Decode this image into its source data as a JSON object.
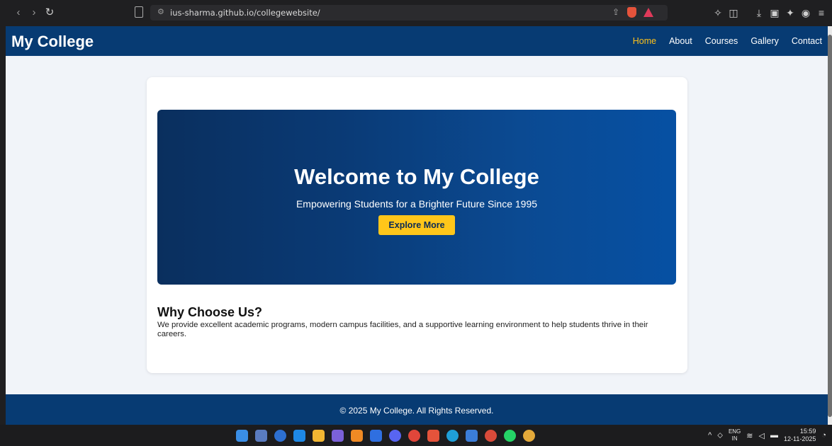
{
  "browser": {
    "url": "ius-sharma.github.io/collegewebsite/",
    "back_icon": "back-icon",
    "forward_icon": "forward-icon",
    "reload_icon": "reload-icon"
  },
  "site": {
    "logo": "My College",
    "nav": [
      {
        "label": "Home",
        "active": true
      },
      {
        "label": "About",
        "active": false
      },
      {
        "label": "Courses",
        "active": false
      },
      {
        "label": "Gallery",
        "active": false
      },
      {
        "label": "Contact",
        "active": false
      }
    ],
    "hero": {
      "title": "Welcome to My College",
      "subtitle": "Empowering Students for a Brighter Future Since 1995",
      "button": "Explore More"
    },
    "why": {
      "heading": "Why Choose Us?",
      "text": "We provide excellent academic programs, modern campus facilities, and a supportive learning environment to help students thrive in their careers."
    },
    "footer": "© 2025 My College. All Rights Reserved."
  },
  "colors": {
    "header_bg": "#073b73",
    "accent": "#ffc21a",
    "page_bg": "#f1f4f9"
  },
  "taskbar": {
    "lang_line1": "ENG",
    "lang_line2": "IN",
    "time": "15:59",
    "date": "12-11-2025"
  }
}
